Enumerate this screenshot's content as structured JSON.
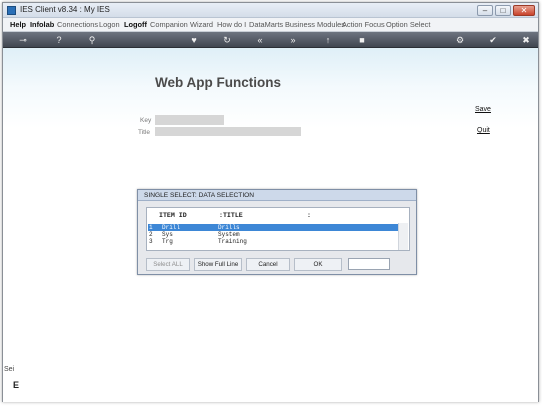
{
  "window": {
    "title": "IES Client v8.34 : My IES",
    "min_label": "–",
    "max_label": "□",
    "close_label": "✕"
  },
  "menu": [
    {
      "label": "Help",
      "bold": true
    },
    {
      "label": "Infolab",
      "bold": true
    },
    {
      "label": "Connections",
      "bold": false
    },
    {
      "label": "Logon",
      "bold": false
    },
    {
      "label": "Logoff",
      "bold": true
    },
    {
      "label": "Companion",
      "bold": false
    },
    {
      "label": "Wizard",
      "bold": false
    },
    {
      "label": "How do I",
      "bold": false
    },
    {
      "label": "DataMarts",
      "bold": false
    },
    {
      "label": "Business Modules",
      "bold": false
    },
    {
      "label": "Action Focus",
      "bold": false
    },
    {
      "label": "Option Select",
      "bold": false
    }
  ],
  "toolbar": {
    "icons": [
      "key-icon",
      "help-icon",
      "search-icon",
      "heart-icon",
      "refresh-icon",
      "rewind-icon",
      "fast-forward-icon",
      "upload-icon",
      "stop-icon",
      "settings-icon",
      "check-icon",
      "close-icon"
    ],
    "glyphs": [
      "⊸",
      "?",
      "⚲",
      "♥",
      "↻",
      "«",
      "»",
      "↑",
      "■",
      "⚙",
      "✔",
      "✖"
    ]
  },
  "page": {
    "title": "Web App Functions",
    "save_label": "Save",
    "quit_label": "Quit",
    "key_label": "Key",
    "title_label": "Title"
  },
  "dialog": {
    "title": "SINGLE SELECT: DATA SELECTION",
    "columns": [
      "ITEM ID",
      ":TITLE",
      ":"
    ],
    "rows": [
      {
        "num": "1",
        "id": "Drill",
        "title": "Drills",
        "selected": true
      },
      {
        "num": "2",
        "id": "Sys",
        "title": "System",
        "selected": false
      },
      {
        "num": "3",
        "id": "Trg",
        "title": "Training",
        "selected": false
      }
    ],
    "buttons": {
      "select_all": "Select ALL",
      "show_full_line": "Show Full Line",
      "cancel": "Cancel",
      "ok": "OK"
    }
  },
  "bottom": {
    "label1": "Sei",
    "label2": "E"
  }
}
